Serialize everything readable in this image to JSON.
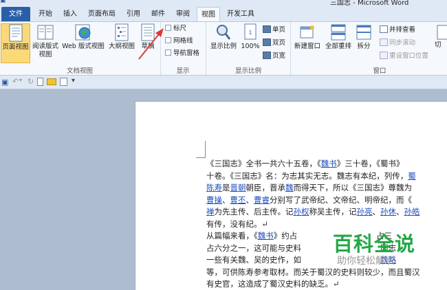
{
  "window": {
    "title": "三国志 - Microsoft Word"
  },
  "tabs": [
    "文件",
    "开始",
    "插入",
    "页面布局",
    "引用",
    "邮件",
    "审阅",
    "视图",
    "开发工具"
  ],
  "ribbon": {
    "doc_views": {
      "group_label": "文档视图",
      "print_layout": "页面视图",
      "full_screen_reading": "阅读版式视图",
      "web_layout": "Web 版式视图",
      "outline": "大纲视图",
      "draft": "草稿"
    },
    "show": {
      "group_label": "显示",
      "ruler": "标尺",
      "gridlines": "网格线",
      "nav_pane": "导航窗格"
    },
    "zoom": {
      "group_label": "显示比例",
      "zoom": "显示比例",
      "hundred": "100%",
      "one_page": "单页",
      "two_pages": "双页",
      "page_width": "页宽"
    },
    "window": {
      "group_label": "窗口",
      "new_window": "新建窗口",
      "arrange_all": "全部重排",
      "split": "拆分",
      "side_by_side": "并排查看",
      "sync_scroll": "同步滚动",
      "reset_position": "重设窗口位置",
      "switch": "切"
    }
  },
  "document": {
    "lines": [
      [
        {
          "t": "《三国志》全书一共六十五卷，《"
        },
        {
          "t": "魏书",
          "link": true
        },
        {
          "t": "》三十卷，《蜀书》"
        }
      ],
      [
        {
          "t": "十卷。《三国志》名：为志其实无志。魏志有本纪，列传，"
        },
        {
          "t": "蜀",
          "link": true
        }
      ],
      [
        {
          "t": "陈寿",
          "link": true
        },
        {
          "t": "是"
        },
        {
          "t": "晋朝",
          "link": true
        },
        {
          "t": "朝臣，晋承"
        },
        {
          "t": "魏",
          "link": true
        },
        {
          "t": "而得天下，所以《三国志》尊魏为"
        }
      ],
      [
        {
          "t": "曹操",
          "link": true
        },
        {
          "t": "、"
        },
        {
          "t": "曹丕",
          "link": true
        },
        {
          "t": "、"
        },
        {
          "t": "曹睿",
          "link": true
        },
        {
          "t": "分别写了武帝纪、文帝纪、明帝纪，而《"
        }
      ],
      [
        {
          "t": "禅",
          "link": true
        },
        {
          "t": "为先主传、后主传。记"
        },
        {
          "t": "孙权",
          "link": true
        },
        {
          "t": "称吴主传，记"
        },
        {
          "t": "孙亮",
          "link": true
        },
        {
          "t": "、"
        },
        {
          "t": "孙休",
          "link": true
        },
        {
          "t": "、"
        },
        {
          "t": "孙皓",
          "link": true
        }
      ],
      [
        {
          "t": "有传，没有纪。↵"
        }
      ],
      [
        {
          "t": "从篇幅来看，《"
        },
        {
          "t": "魏书",
          "link": true
        },
        {
          "t": "》约占　　　　　　　　　　占三"
        }
      ],
      [
        {
          "t": "占六分之一，这可能与史料　　　　　　　　　　国志"
        }
      ],
      [
        {
          "t": "一些有关魏、吴的史作，如　　　　　　　　　　"
        },
        {
          "t": "魏略",
          "link": true
        }
      ],
      [
        {
          "t": "等，可供陈寿参考取材。而关于蜀汉的史料则较少，而且蜀汉"
        }
      ],
      [
        {
          "t": "有史官，这造成了蜀汉史料的缺乏。↵"
        }
      ]
    ]
  },
  "watermark": {
    "brand": "百科全说",
    "slogan": "助你轻松解决"
  },
  "colors": {
    "accent": "#2a5fa8",
    "link": "#1f4fbf",
    "watermark": "#22a846",
    "arrow": "#e03a2f"
  }
}
